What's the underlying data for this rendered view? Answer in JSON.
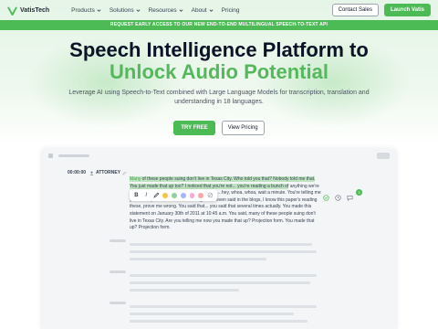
{
  "nav": {
    "logo_text": "VatisTech",
    "menu": [
      {
        "label": "Products",
        "has_dropdown": true
      },
      {
        "label": "Solutions",
        "has_dropdown": true
      },
      {
        "label": "Resources",
        "has_dropdown": true
      },
      {
        "label": "About",
        "has_dropdown": true
      },
      {
        "label": "Pricing",
        "has_dropdown": false
      }
    ],
    "contact_sales": "Contact Sales",
    "launch": "Launch Vatis"
  },
  "banner": {
    "text": "REQUEST EARLY ACCESS TO OUR NEW END-TO-END MULTILINGUAL SPEECH-TO-TEXT API"
  },
  "hero": {
    "title_line1": "Speech Intelligence Platform to",
    "title_line2": "Unlock Audio Potential",
    "subtitle": "Leverage AI using Speech-to-Text combined with Large Language Models for transcription, translation and understanding in 18 languages.",
    "cta_primary": "TRY FREE",
    "cta_secondary": "View Pricing"
  },
  "app_preview": {
    "timestamp": "00:00:00",
    "speaker": "ATTORNEY",
    "transcript": {
      "lead_accent": "Many",
      "highlighted": " of these people suing don't live in Texas City. Who told you that? Nobody told me that. You just made that up too? I noticed that you're not... you're reading a bunch of",
      "rest": " anything we're not putting in it paper that I make darn sure ...hey, whoa, whoa, wait a minute. You're telling me you... You put this stuff in these blogs. You even said in the blogs, I know this paper's reading these, prove me wrong. You said that... you said that several times actually. You made this statement on January 30th of 2011 at 10:45 a.m. You said, many of these people suing don't live in Texas City. Are you telling me now you made that up? Projection form. You made that up? Projection form."
    },
    "toolbar": {
      "bold": "B",
      "italic": "I",
      "swatches": [
        "#f5c542",
        "#8fd19e",
        "#a5b4fc",
        "#f9a8d4",
        "#fca5a5"
      ]
    },
    "comment_count": "3",
    "colors": {
      "accent": "#4cba55",
      "highlight": "#bfe3c0"
    }
  }
}
